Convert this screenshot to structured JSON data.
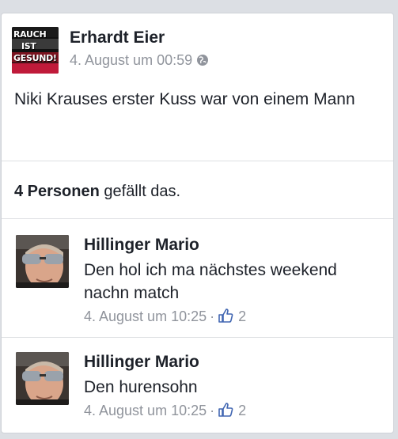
{
  "post": {
    "author": "Erhardt Eier",
    "page_logo_lines": [
      "RAUCH",
      "IST",
      "GESUND!"
    ],
    "timestamp": "4. August um 00:59",
    "privacy_icon": "globe-icon",
    "text": "Niki Krauses erster Kuss war von einem Mann"
  },
  "likes": {
    "count_text": "4 Personen",
    "suffix": " gefällt das."
  },
  "comments": [
    {
      "author": "Hillinger Mario",
      "text": "Den hol ich ma nächstes weekend nachn match",
      "timestamp": "4. August um 10:25",
      "separator": "·",
      "like_icon": "thumbs-up-icon",
      "likes": "2"
    },
    {
      "author": "Hillinger Mario",
      "text": "Den hurensohn",
      "timestamp": "4. August um 10:25",
      "separator": "·",
      "like_icon": "thumbs-up-icon",
      "likes": "2"
    }
  ],
  "colors": {
    "background": "#dcdfe4",
    "text": "#1d2129",
    "meta": "#90949c",
    "like_blue": "#4267b2"
  }
}
